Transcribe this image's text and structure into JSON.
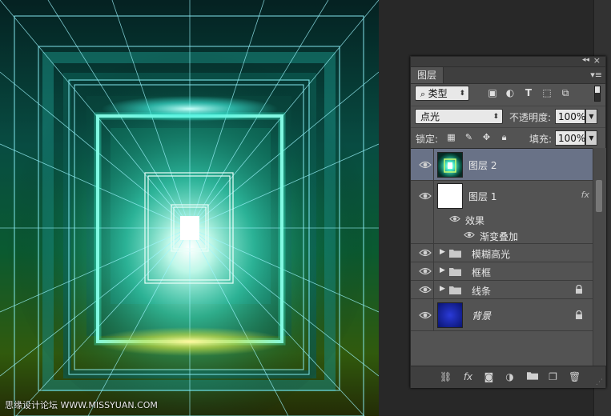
{
  "canvas": {
    "watermark": "思缘设计论坛 WWW.MISSYUAN.COM"
  },
  "panel": {
    "tab_label": "图层",
    "filter": {
      "kind_label": "类型",
      "icons": [
        "image-filter-icon",
        "adjustment-filter-icon",
        "type-filter-icon",
        "shape-filter-icon",
        "smart-object-filter-icon"
      ]
    },
    "blend_mode": "点光",
    "opacity_label": "不透明度:",
    "opacity_value": "100%",
    "lock_label": "锁定:",
    "fill_label": "填充:",
    "fill_value": "100%",
    "layers": [
      {
        "name": "图层 2",
        "selected": true,
        "type": "pixel"
      },
      {
        "name": "图层 1",
        "selected": false,
        "type": "pixel",
        "fx": "fx"
      },
      {
        "name": "效果",
        "type": "effects-header"
      },
      {
        "name": "渐变叠加",
        "type": "effect"
      },
      {
        "name": "模糊高光",
        "type": "group"
      },
      {
        "name": "框框",
        "type": "group"
      },
      {
        "name": "线条",
        "type": "group",
        "locked": true
      },
      {
        "name": "背景",
        "type": "background",
        "locked": true
      }
    ],
    "bottom_icons": [
      "link-icon",
      "fx-icon",
      "mask-icon",
      "adjustment-icon",
      "group-folder-icon",
      "new-layer-icon",
      "trash-icon"
    ],
    "fx_text": "fx"
  },
  "colors": {
    "selected_row": "#697287",
    "panel_bg": "#535353",
    "canvas_glow": "#3ff0dc",
    "canvas_bottom": "#c8d830"
  }
}
